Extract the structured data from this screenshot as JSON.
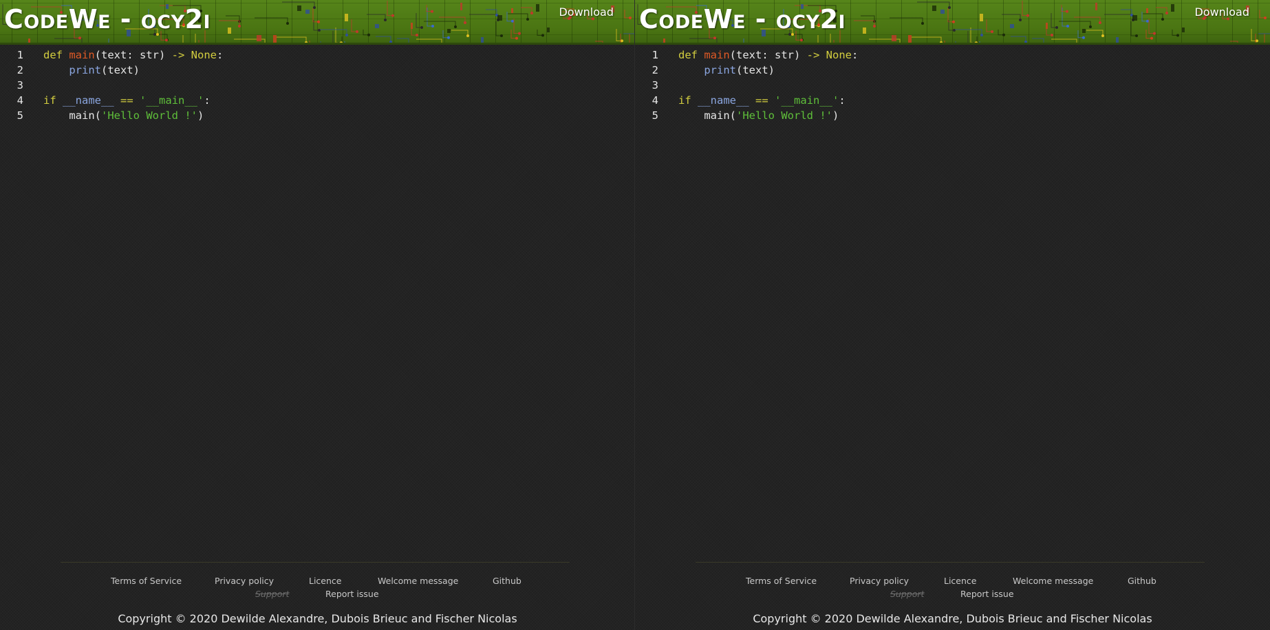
{
  "panes": [
    {
      "header": {
        "title": "CodeWe - ocy2i",
        "download_label": "Download"
      },
      "editor": {
        "lines": [
          {
            "number": "1"
          },
          {
            "number": "2"
          },
          {
            "number": "3"
          },
          {
            "number": "4"
          },
          {
            "number": "5"
          }
        ]
      },
      "footer": {
        "links": {
          "terms": "Terms of Service",
          "privacy": "Privacy policy",
          "licence": "Licence",
          "welcome": "Welcome message",
          "github": "Github",
          "support": "Support",
          "report": "Report issue"
        },
        "copyright": "Copyright © 2020 Dewilde Alexandre, Dubois Brieuc and Fischer Nicolas"
      }
    },
    {
      "header": {
        "title": "CodeWe - ocy2i",
        "download_label": "Download"
      },
      "editor": {
        "lines": [
          {
            "number": "1"
          },
          {
            "number": "2"
          },
          {
            "number": "3"
          },
          {
            "number": "4"
          },
          {
            "number": "5"
          }
        ]
      },
      "footer": {
        "links": {
          "terms": "Terms of Service",
          "privacy": "Privacy policy",
          "licence": "Licence",
          "welcome": "Welcome message",
          "github": "Github",
          "support": "Support",
          "report": "Report issue"
        },
        "copyright": "Copyright © 2020 Dewilde Alexandre, Dubois Brieuc and Fischer Nicolas"
      }
    }
  ],
  "code": {
    "l1": {
      "kw": "def",
      "sp1": " ",
      "fn": "main",
      "p1": "(text: str) ",
      "arrow": "->",
      "sp2": " ",
      "none": "None",
      "colon": ":"
    },
    "l2": {
      "indent": "    ",
      "bi": "print",
      "rest": "(text)"
    },
    "l3": {
      "text": ""
    },
    "l4": {
      "kw": "if",
      "sp1": " ",
      "dunder": "__name__",
      "sp2": " ",
      "op": "==",
      "sp3": " ",
      "str": "'__main__'",
      "colon": ":"
    },
    "l5": {
      "indent": "    ",
      "call": "main(",
      "str": "'Hello World !'",
      "close": ")"
    }
  },
  "colors": {
    "background": "#232323",
    "header_green": "#4e7a13",
    "keyword": "#d3ce3f",
    "function": "#e05a26",
    "builtin": "#8ba6e0",
    "string": "#5fbf3a"
  }
}
